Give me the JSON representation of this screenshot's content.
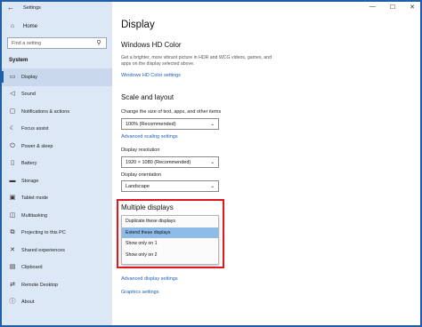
{
  "window": {
    "title": "Settings",
    "minimize": "—",
    "maximize": "☐",
    "close": "✕"
  },
  "sidebar": {
    "home": "Home",
    "search_placeholder": "Find a setting",
    "section": "System",
    "items": [
      {
        "label": "Display",
        "icon": "display-icon"
      },
      {
        "label": "Sound",
        "icon": "sound-icon"
      },
      {
        "label": "Notifications & actions",
        "icon": "notifications-icon"
      },
      {
        "label": "Focus assist",
        "icon": "focus-assist-icon"
      },
      {
        "label": "Power & sleep",
        "icon": "power-icon"
      },
      {
        "label": "Battery",
        "icon": "battery-icon"
      },
      {
        "label": "Storage",
        "icon": "storage-icon"
      },
      {
        "label": "Tablet mode",
        "icon": "tablet-icon"
      },
      {
        "label": "Multitasking",
        "icon": "multitasking-icon"
      },
      {
        "label": "Projecting to this PC",
        "icon": "projecting-icon"
      },
      {
        "label": "Shared experiences",
        "icon": "shared-icon"
      },
      {
        "label": "Clipboard",
        "icon": "clipboard-icon"
      },
      {
        "label": "Remote Desktop",
        "icon": "remote-desktop-icon"
      },
      {
        "label": "About",
        "icon": "about-icon"
      }
    ]
  },
  "main": {
    "title": "Display",
    "hd_color": {
      "heading": "Windows HD Color",
      "description": "Get a brighter, more vibrant picture in HDR and WCG videos, games, and apps on the display selected above.",
      "link": "Windows HD Color settings"
    },
    "scale": {
      "heading": "Scale and layout",
      "size_label": "Change the size of text, apps, and other items",
      "size_value": "100% (Recommended)",
      "advanced_link": "Advanced scaling settings",
      "resolution_label": "Display resolution",
      "resolution_value": "1920 × 1080 (Recommended)",
      "orientation_label": "Display orientation",
      "orientation_value": "Landscape"
    },
    "multiple": {
      "heading": "Multiple displays",
      "options": [
        "Duplicate these displays",
        "Extend these displays",
        "Show only on 1",
        "Show only on 2"
      ],
      "selected_index": 1
    },
    "links": {
      "advanced_display": "Advanced display settings",
      "graphics": "Graphics settings"
    }
  },
  "colors": {
    "accent": "#1f5fa8",
    "link": "#1a5fb4",
    "highlight": "#e0171d",
    "selected_option": "#8fbbe8",
    "sidebar_bg": "#dde8f6"
  }
}
